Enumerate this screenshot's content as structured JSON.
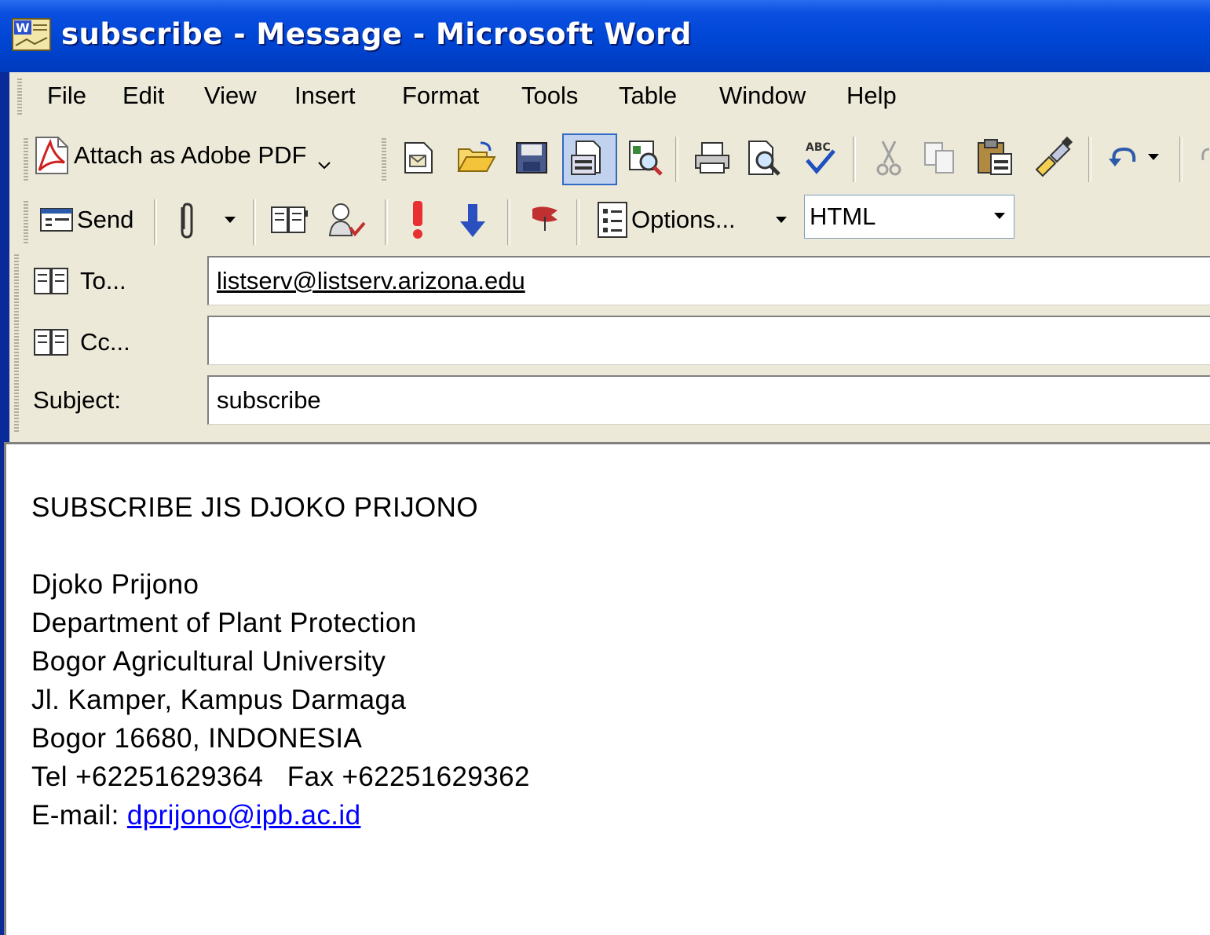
{
  "window": {
    "title": "subscribe - Message - Microsoft Word",
    "app_icon": "word-doc-icon"
  },
  "menu": [
    "File",
    "Edit",
    "View",
    "Insert",
    "Format",
    "Tools",
    "Table",
    "Window",
    "Help"
  ],
  "toolbar_standard": {
    "attach_pdf_label": "Attach as Adobe PDF",
    "icons": [
      "new-icon",
      "open-icon",
      "save-icon",
      "permission-icon",
      "search-icon",
      "print-icon",
      "print-preview-icon",
      "spelling-icon",
      "cut-icon",
      "copy-icon",
      "paste-icon",
      "format-painter-icon",
      "undo-icon",
      "redo-icon"
    ]
  },
  "toolbar_email": {
    "send_label": "Send",
    "options_label": "Options...",
    "format_value": "HTML",
    "icons": [
      "paperclip-icon",
      "address-book-icon",
      "check-names-icon",
      "high-importance-icon",
      "low-importance-icon",
      "flag-icon"
    ]
  },
  "header": {
    "to_label": "To...",
    "to_value": "listserv@listserv.arizona.edu",
    "cc_label": "Cc...",
    "cc_value": "",
    "subject_label": "Subject:",
    "subject_value": "subscribe"
  },
  "body": {
    "line1": "SUBSCRIBE JIS DJOKO PRIJONO",
    "line2": "Djoko Prijono",
    "line3": "Department of Plant Protection",
    "line4": "Bogor Agricultural University",
    "line5": "Jl. Kamper, Kampus Darmaga",
    "line6": "Bogor 16680, INDONESIA",
    "line7": "Tel +62251629364   Fax +62251629362",
    "email_prefix": "E-mail: ",
    "email_link": "dprijono@ipb.ac.id"
  },
  "colors": {
    "titlebar": "#0046d5",
    "chrome": "#ece9d8",
    "link": "#0000ff"
  }
}
